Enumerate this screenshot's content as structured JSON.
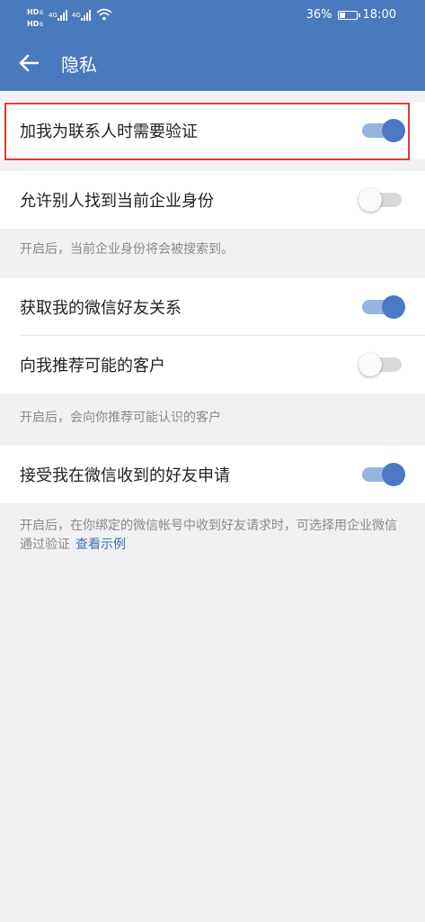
{
  "status_bar": {
    "signal_left": "HDᴮ 4G.ıll 4G.ıll",
    "battery_text": "36%",
    "battery_level": 0.36,
    "time": "18:00"
  },
  "header": {
    "back_icon": "arrow-left-icon",
    "title": "隐私"
  },
  "colors": {
    "header_bg": "#4a79bd",
    "toggle_on": "#4a79c5",
    "highlight": "#e53935",
    "link": "#3c6fb8"
  },
  "settings": {
    "add_verify": {
      "label": "加我为联系人时需要验证",
      "on": true
    },
    "find_identity": {
      "label": "允许别人找到当前企业身份",
      "on": false
    },
    "find_identity_hint": "开启后，当前企业身份将会被搜索到。",
    "wechat_friends": {
      "label": "获取我的微信好友关系",
      "on": true
    },
    "recommend_clients": {
      "label": "向我推荐可能的客户",
      "on": false
    },
    "recommend_hint": "开启后，会向你推荐可能认识的客户",
    "accept_wechat_requests": {
      "label": "接受我在微信收到的好友申请",
      "on": true
    },
    "accept_hint": "开启后，在你绑定的微信帐号中收到好友请求时，可选择用企业微信通过验证",
    "accept_hint_link": "查看示例"
  }
}
